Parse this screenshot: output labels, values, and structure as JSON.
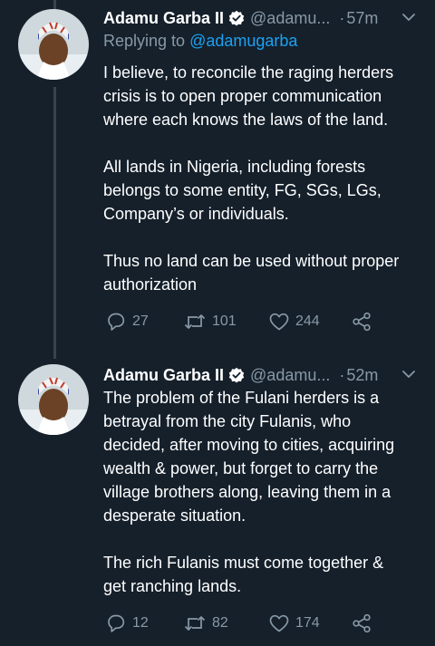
{
  "colors": {
    "background": "#15202b",
    "secondary_text": "#8899a6",
    "link": "#1da1f2",
    "thread_line": "#38444d"
  },
  "tweets": [
    {
      "name": "Adamu Garba II",
      "handle": "@adamu...",
      "dot": "·",
      "time": "57m",
      "replying_prefix": "Replying to ",
      "replying_to": "@adamugarba",
      "paragraphs": [
        [
          "I believe, to reconcile the raging herders",
          "crisis is to open proper communication",
          "where each knows the laws of the land."
        ],
        [
          "All lands in Nigeria, including forests",
          "belongs to some entity, FG, SGs, LGs,",
          "Company’s or individuals."
        ],
        [
          "Thus no land can be used without proper",
          "authorization"
        ]
      ],
      "actions": {
        "replies": "27",
        "retweets": "101",
        "likes": "244"
      }
    },
    {
      "name": "Adamu Garba II",
      "handle": "@adamu...",
      "dot": "·",
      "time": "52m",
      "paragraphs": [
        [
          "The problem of the Fulani herders is a",
          "betrayal from the city Fulanis, who",
          "decided, after moving to cities, acquiring",
          "wealth & power, but forget to carry the",
          "village brothers along, leaving them in a",
          "desperate situation."
        ],
        [
          "The rich Fulanis must come together &",
          "get ranching lands."
        ]
      ],
      "actions": {
        "replies": "12",
        "retweets": "82",
        "likes": "174"
      }
    }
  ],
  "icons": {
    "verified": "verified-badge-icon",
    "caret": "chevron-down-icon",
    "reply": "reply-icon",
    "retweet": "retweet-icon",
    "like": "heart-icon",
    "share": "share-icon"
  }
}
